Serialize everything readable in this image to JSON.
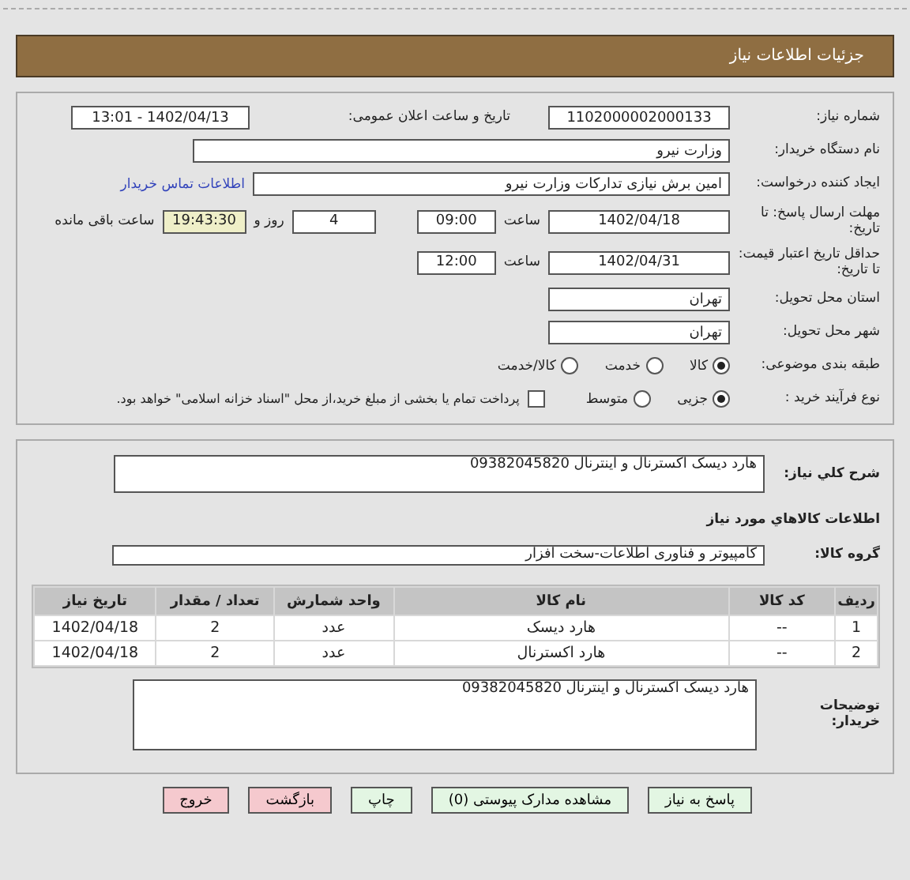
{
  "header": {
    "title": "جزئیات اطلاعات نیاز"
  },
  "info": {
    "need_number": {
      "label": "شماره نیاز:",
      "value": "1102000002000133"
    },
    "announce": {
      "label": "تاریخ و ساعت اعلان عمومی:",
      "value": "1402/04/13 - 13:01"
    },
    "buyer": {
      "label": "نام دستگاه خریدار:",
      "value": "وزارت نیرو"
    },
    "creator": {
      "label": "ایجاد کننده درخواست:",
      "value": "امین برش نیازی تدارکات وزارت نیرو",
      "link": "اطلاعات تماس خریدار"
    },
    "deadline": {
      "label": "مهلت ارسال پاسخ: تا تاریخ:",
      "date": "1402/04/18",
      "time_label": "ساعت",
      "time": "09:00",
      "days": "4",
      "days_label": "روز و",
      "remaining": "19:43:30",
      "remaining_label": "ساعت باقی مانده"
    },
    "validity": {
      "label": "حداقل تاریخ اعتبار قیمت: تا تاریخ:",
      "date": "1402/04/31",
      "time_label": "ساعت",
      "time": "12:00"
    },
    "province": {
      "label": "استان محل تحویل:",
      "value": "تهران"
    },
    "city": {
      "label": "شهر محل تحویل:",
      "value": "تهران"
    },
    "category": {
      "label": "طبقه بندی موضوعی:",
      "options": [
        {
          "label": "کالا",
          "selected": true
        },
        {
          "label": "خدمت",
          "selected": false
        },
        {
          "label": "کالا/خدمت",
          "selected": false
        }
      ]
    },
    "process": {
      "label": "نوع فرآیند خرید :",
      "options": [
        {
          "label": "جزیی",
          "selected": true
        },
        {
          "label": "متوسط",
          "selected": false
        }
      ],
      "payment": {
        "checked": false,
        "text": "پرداخت تمام یا بخشی از مبلغ خرید،از محل \"اسناد خزانه اسلامی\" خواهد بود."
      }
    }
  },
  "details": {
    "description": {
      "label": "شرح کلي نياز:",
      "value": "هارد دیسک اکسترنال و اینترنال 09382045820"
    },
    "goods_title": "اطلاعات کالاهاي مورد نياز",
    "group": {
      "label": "گروه کالا:",
      "value": "کامپیوتر و فناوری اطلاعات-سخت افزار"
    },
    "table": {
      "columns": [
        "ردیف",
        "کد کالا",
        "نام کالا",
        "واحد شمارش",
        "تعداد / مقدار",
        "تاریخ نیاز"
      ],
      "rows": [
        [
          "1",
          "--",
          "هارد دیسک",
          "عدد",
          "2",
          "1402/04/18"
        ],
        [
          "2",
          "--",
          "هارد اکسترنال",
          "عدد",
          "2",
          "1402/04/18"
        ]
      ]
    },
    "notes": {
      "label": "توضیحات خریدار:",
      "value": "هارد دیسک اکسترنال و اینترنال 09382045820"
    }
  },
  "buttons": [
    {
      "label": "پاسخ به نیاز",
      "kind": "action"
    },
    {
      "label": "مشاهده مدارک پیوستی (0)",
      "kind": "action"
    },
    {
      "label": "چاپ",
      "kind": "action"
    },
    {
      "label": "بازگشت",
      "kind": "exit"
    },
    {
      "label": "خروج",
      "kind": "exit"
    }
  ]
}
